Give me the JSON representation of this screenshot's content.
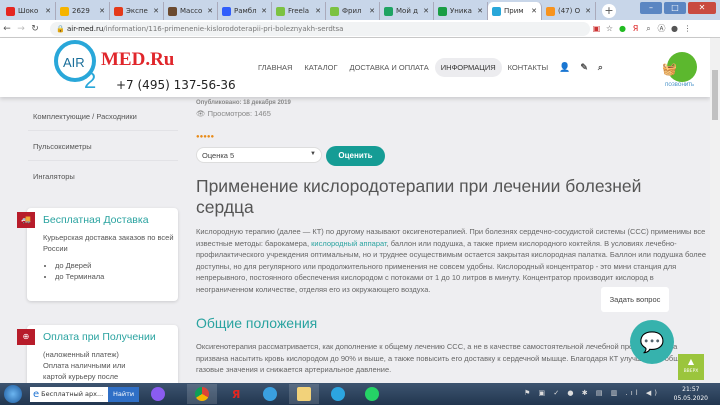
{
  "browser": {
    "tabs": [
      {
        "title": "Шоко",
        "icon": "yandex-icon",
        "color": "#e52620"
      },
      {
        "title": "2629",
        "icon": "mail-icon",
        "color": "#f5b400"
      },
      {
        "title": "Экспе",
        "icon": "fire-icon",
        "color": "#e43a1a"
      },
      {
        "title": "Массо",
        "icon": "image-icon",
        "color": "#6b4a2f"
      },
      {
        "title": "Рамбл",
        "icon": "rambler-icon",
        "color": "#315efb"
      },
      {
        "title": "Freela",
        "icon": "freelance-icon",
        "color": "#7cc242"
      },
      {
        "title": "Фрил",
        "icon": "freelance-icon",
        "color": "#7cc242"
      },
      {
        "title": "Мой д",
        "icon": "drive-icon",
        "color": "#1fa463"
      },
      {
        "title": "Уника",
        "icon": "plus-icon",
        "color": "#1b9e45"
      },
      {
        "title": "Прим",
        "icon": "airmed-icon",
        "color": "#29a7d9",
        "active": true
      },
      {
        "title": "(47) О",
        "icon": "ok-icon",
        "color": "#f7931e"
      }
    ],
    "url_domain": "air-med.ru",
    "url_path": "/information/116-primenenie-kislorodoterapii-pri-boleznyakh-serdtsa"
  },
  "site": {
    "logo_air": "AIR",
    "logo_2": "2",
    "logo_med": "MED.Ru",
    "phone": "+7 (495) 137-56-36",
    "menu": [
      "ГЛАВНАЯ",
      "КАТАЛОГ",
      "ДОСТАВКА И ОПЛАТА",
      "ИНФОРМАЦИЯ",
      "КОНТАКТЫ"
    ],
    "call_label": "ПОЗВОНИТЬ"
  },
  "sidebar": {
    "categories": [
      "Комплектующие / Расходники",
      "Пульсоксиметры",
      "Ингаляторы"
    ],
    "delivery": {
      "title": "Бесплатная Доставка",
      "text": "Курьерская доставка заказов по всей России",
      "items": [
        "до Дверей",
        "до Терминала"
      ]
    },
    "payment": {
      "title": "Оплата при Получении",
      "line1": "(наложенный платеж)",
      "line2": "Оплата наличными или",
      "line3": "картой курьеру после"
    }
  },
  "article": {
    "published": "Опубликовано: 18 декабря 2019",
    "views": "Просмотров: 1465",
    "stars": "●●●●●",
    "rating_select": "Оценка 5",
    "rate_button": "Оценить",
    "title": "Применение кислородотерапии при лечении болезней сердца",
    "p1_a": "Кислородную терапию (далее — КТ) по другому называют оксигенотерапией. При болезнях сердечно-сосудистой системы (ССС) применимы все известные методы: барокамера, ",
    "p1_link": "кислородный аппарат",
    "p1_b": ", баллон или подушка, а также прием кислородного коктейля. В условиях лечебно-профилактического учреждения оптимальным, но и труднее осуществимым остается закрытая кислородная палатка. Баллон или подушка более доступны, но для регулярного или продолжительного применения не совсем удобны. Кислородный концентратор - это мини станция для непрерывного, постоянного обеспечения кислородом с потоками от 1 до 10 литров в минуту. Концентратор производит кислород в неограниченном количестве, отделяя его из окружающего воздуха.",
    "h2": "Общие положения",
    "p2": "Оксигенотерапия рассматривается, как дополнение к общему лечению ССС, а не в качестве самостоятельной лечебной процедуры. Она призвана насытить кровь кислородом до 90% и выше, а также повысить его доставку к сердечной мышце. Благодаря КТ улучшаются общие газовые значения и снижается артериальное давление."
  },
  "widgets": {
    "ask_tooltip": "Задать вопрос",
    "up_label": "ВВЕРХ"
  },
  "taskbar": {
    "search_text": "Бесплатный арх...",
    "search_button": "Найти",
    "time": "21:57",
    "date": "05.05.2020"
  }
}
